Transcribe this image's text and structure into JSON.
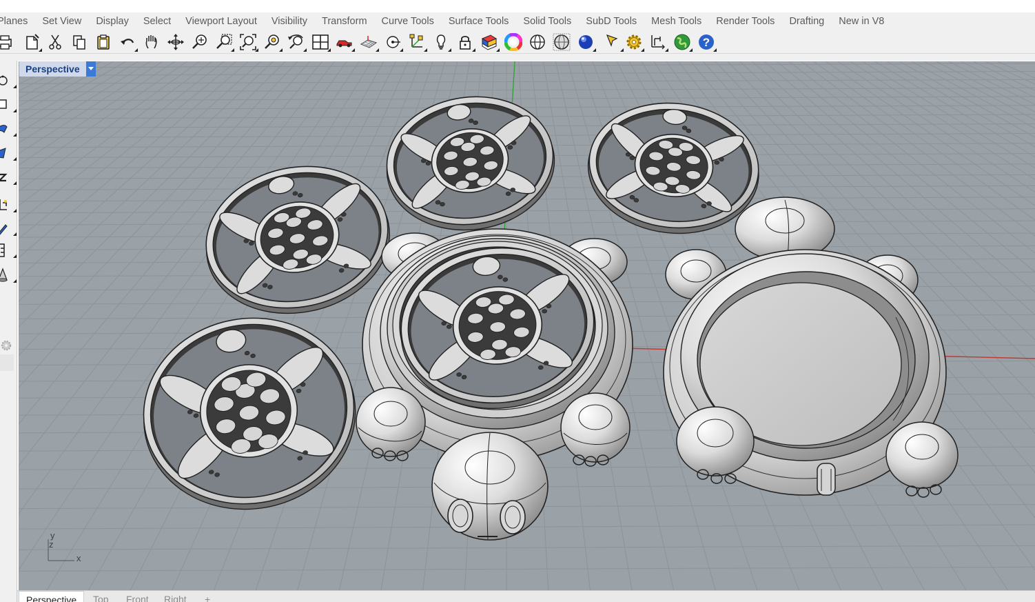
{
  "menu_tabs": [
    "Planes",
    "Set View",
    "Display",
    "Select",
    "Viewport Layout",
    "Visibility",
    "Transform",
    "Curve Tools",
    "Surface Tools",
    "Solid Tools",
    "SubD Tools",
    "Mesh Tools",
    "Render Tools",
    "Drafting",
    "New in V8"
  ],
  "toolbar_icons": [
    "print-icon",
    "new-document-icon",
    "cut-icon",
    "copy-icon",
    "paste-icon",
    "undo-icon",
    "pan-hand-icon",
    "rotate-view-icon",
    "zoom-icon",
    "zoom-window-icon",
    "zoom-extents-icon",
    "zoom-selected-icon",
    "undo-view-icon",
    "four-viewports-icon",
    "car-properties-icon",
    "cplane-icon",
    "osnap-icon",
    "gumball-icon",
    "light-icon",
    "lock-icon",
    "layer-book-icon",
    "color-wheel-icon",
    "wireframe-sphere-icon",
    "shaded-sphere-icon",
    "rendered-sphere-icon",
    "select-arrow-icon",
    "settings-gear-icon",
    "dimension-icon",
    "earth-icon",
    "help-icon"
  ],
  "left_tool_icons": [
    "point-icon",
    "curve-icon",
    "surface-icon",
    "solid-icon",
    "text-icon",
    "transform-icon",
    "pencil-icon",
    "array-icon",
    "cone-icon"
  ],
  "viewport": {
    "title": "Perspective",
    "background_color": "#9aa1a7",
    "axis_x_label": "x",
    "axis_y_label": "y",
    "axis_z_label": "z"
  },
  "viewport_tabs": [
    "Perspective",
    "Top",
    "Front",
    "Right"
  ],
  "viewport_tabs_add": "+"
}
